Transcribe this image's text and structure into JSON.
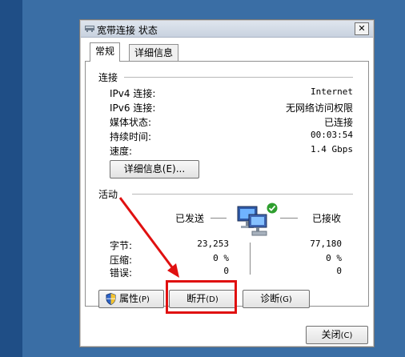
{
  "window": {
    "title": "宽带连接 状态",
    "close_glyph": "✕"
  },
  "tabs": [
    {
      "label": "常规"
    },
    {
      "label": "详细信息"
    }
  ],
  "connection": {
    "heading": "连接",
    "rows": [
      {
        "label": "IPv4 连接:",
        "value": "Internet"
      },
      {
        "label": "IPv6 连接:",
        "value": "无网络访问权限"
      },
      {
        "label": "媒体状态:",
        "value": "已连接"
      },
      {
        "label": "持续时间:",
        "value": "00:03:54"
      },
      {
        "label": "速度:",
        "value": "1.4 Gbps"
      }
    ],
    "details_button": "详细信息(E)..."
  },
  "activity": {
    "heading": "活动",
    "sent_label": "已发送",
    "received_label": "已接收",
    "rows": [
      {
        "label": "字节:",
        "sent": "23,253",
        "received": "77,180"
      },
      {
        "label": "压缩:",
        "sent": "0 %",
        "received": "0 %"
      },
      {
        "label": "错误:",
        "sent": "0",
        "received": "0"
      }
    ]
  },
  "buttons": {
    "properties": "属性",
    "properties_key": "(P)",
    "disconnect": "断开",
    "disconnect_key": "(D)",
    "diagnose": "诊断",
    "diagnose_key": "(G)",
    "close": "关闭",
    "close_key": "(C)"
  },
  "colors": {
    "desktop": "#3a6ea5",
    "annotation": "#e01010"
  },
  "icons": {
    "title": "network-adapter-icon",
    "properties": "shield-icon",
    "activity": "network-computers-icon",
    "status": "green-check-icon"
  }
}
